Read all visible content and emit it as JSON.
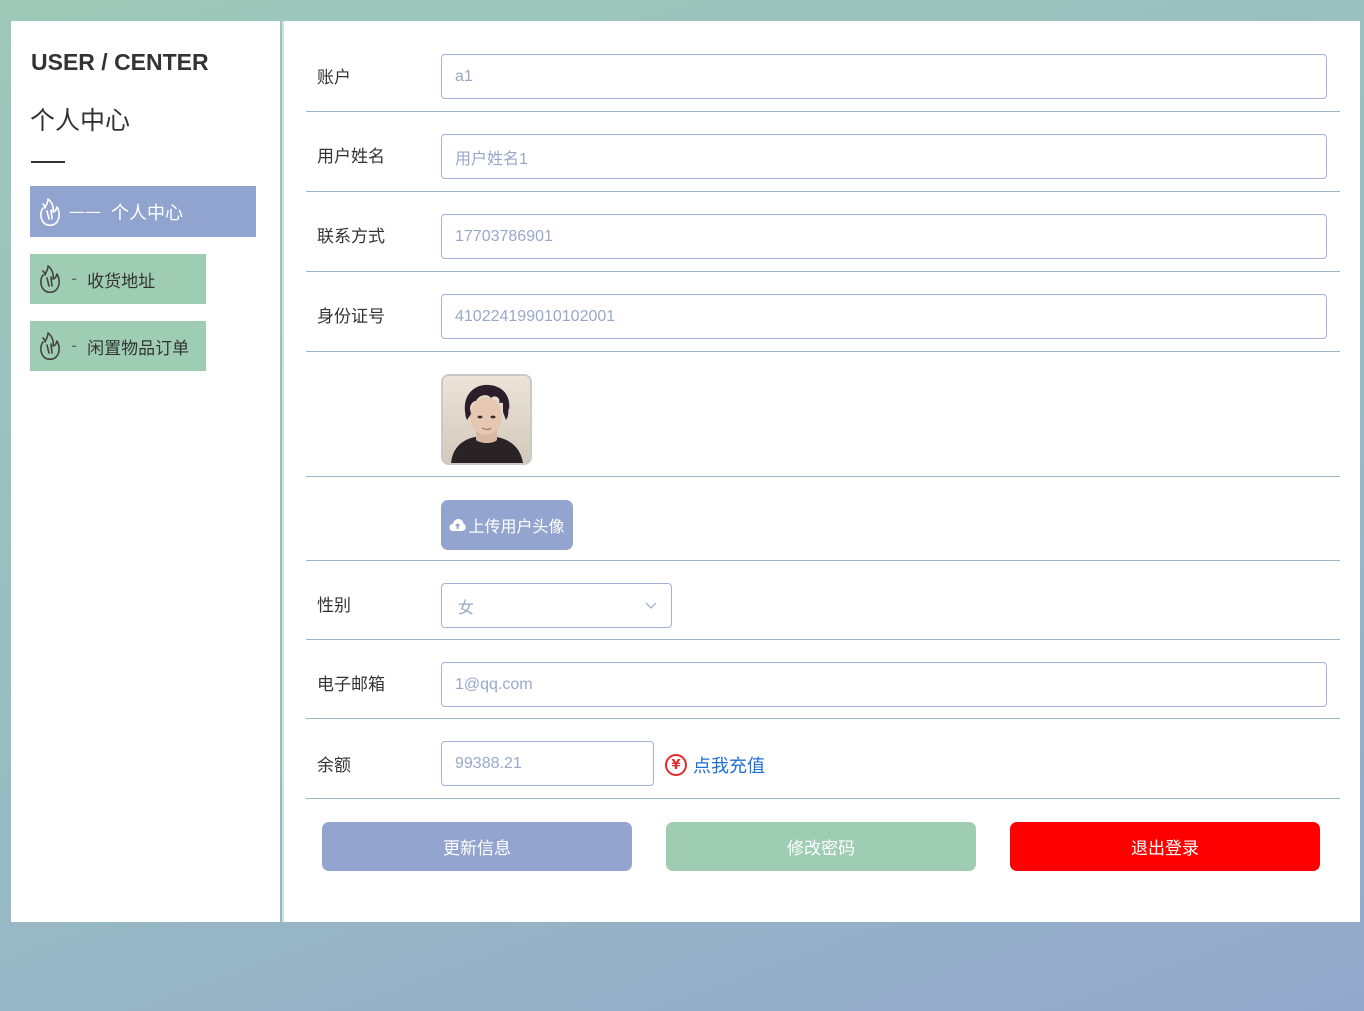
{
  "sidebar": {
    "title_en": "USER / CENTER",
    "title_cn": "个人中心",
    "items": [
      {
        "dash": "——",
        "label": "个人中心",
        "icon": "flame-icon",
        "active": true
      },
      {
        "dash": "-",
        "label": "收货地址",
        "icon": "flame-icon",
        "active": false
      },
      {
        "dash": "-",
        "label": "闲置物品订单",
        "icon": "flame-icon",
        "active": false
      }
    ]
  },
  "form": {
    "account": {
      "label": "账户",
      "value": "a1"
    },
    "username": {
      "label": "用户姓名",
      "value": "用户姓名1"
    },
    "phone": {
      "label": "联系方式",
      "value": "17703786901"
    },
    "id_number": {
      "label": "身份证号",
      "value": "410224199010102001"
    },
    "avatar": {
      "image": "user-avatar-photo"
    },
    "upload": {
      "label": "上传用户头像",
      "icon": "cloud-upload-icon"
    },
    "gender": {
      "label": "性别",
      "value": "女",
      "icon": "chevron-down-icon"
    },
    "email": {
      "label": "电子邮箱",
      "value": "1@qq.com"
    },
    "balance": {
      "label": "余额",
      "value": "99388.21",
      "recharge_icon": "¥",
      "recharge_label": "点我充值"
    }
  },
  "buttons": {
    "update": "更新信息",
    "change_password": "修改密码",
    "logout": "退出登录"
  },
  "colors": {
    "primary": "#93a5cf",
    "secondary": "#9ecdb3",
    "danger": "#ff0000",
    "link": "#1f6fd6"
  }
}
